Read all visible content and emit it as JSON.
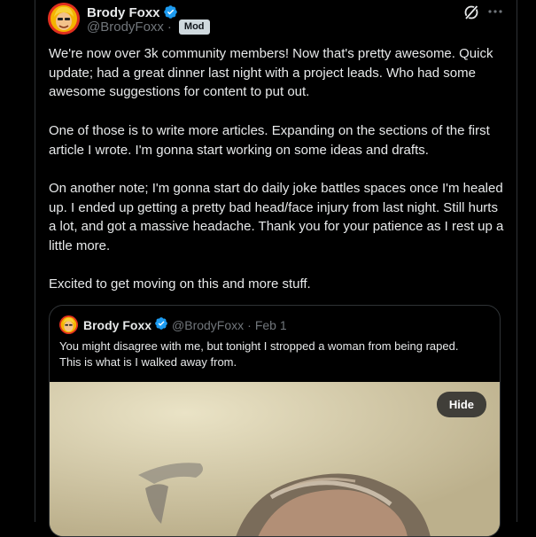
{
  "post": {
    "author_name": "Brody Foxx",
    "handle": "@BrodyFoxx",
    "separator": "·",
    "badge": "Mod",
    "paragraphs": [
      "We're now over 3k community members! Now that's pretty awesome. Quick update; had a great dinner last night with a project leads. Who had some awesome suggestions for content to put out.",
      "One of those is to write more articles. Expanding on the sections of the first article I wrote. I'm gonna start working on some ideas and drafts.",
      "On another note; I'm gonna start do daily joke battles spaces once I'm healed up. I ended up getting a pretty bad head/face injury from last night. Still hurts a lot, and got a massive headache. Thank you for your patience as I rest up a little more.",
      "Excited to get moving on this and more stuff."
    ]
  },
  "quote": {
    "author_name": "Brody Foxx",
    "handle": "@BrodyFoxx",
    "separator": "·",
    "date": "Feb 1",
    "lines": [
      "You might disagree with me,  but tonight I stropped a woman from being raped.",
      "This is what is I walked away from."
    ],
    "hide_label": "Hide"
  },
  "icons": {
    "verified": "verified-badge-icon",
    "grok": "grok-icon",
    "more": "more-options-icon"
  },
  "colors": {
    "background": "#000000",
    "text": "#e7e9ea",
    "muted": "#71767b",
    "verified": "#1d9bf0",
    "border": "#2f3336"
  }
}
